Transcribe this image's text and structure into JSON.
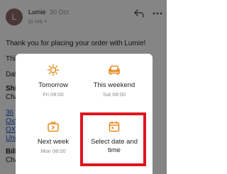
{
  "email": {
    "avatar_letter": "L",
    "sender": "Lumie",
    "date": "30 Oct",
    "to": "to me",
    "body_lines": [
      "Thank you for placing your order with Lumie!",
      "Thi",
      "Dat",
      "Shi",
      "Cha",
      "36",
      "Oxf",
      "OX",
      "Uni",
      "Bill",
      "Cha"
    ]
  },
  "snooze_menu": {
    "options": [
      {
        "title": "Tomorrow",
        "subtitle": "Fri 08:00",
        "icon": "sun-icon"
      },
      {
        "title": "This weekend",
        "subtitle": "Sat 08:00",
        "icon": "sofa-icon"
      },
      {
        "title": "Next week",
        "subtitle": "Mon 08:00",
        "icon": "briefcase-icon"
      },
      {
        "title": "Select date and time",
        "subtitle": "",
        "icon": "calendar-icon"
      }
    ]
  },
  "colors": {
    "accent": "#e8891f",
    "highlight": "#e0141e",
    "link": "#1a56c9"
  }
}
